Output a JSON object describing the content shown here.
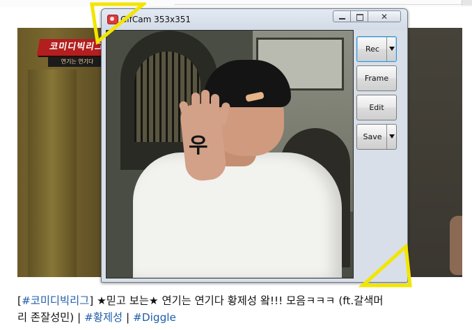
{
  "window": {
    "title": "GifCam 353x351",
    "min_label": "",
    "max_label": "",
    "close_label": "✕"
  },
  "buttons": {
    "rec": "Rec",
    "frame": "Frame",
    "edit": "Edit",
    "save": "Save"
  },
  "video": {
    "logo_main": "코미디빅리그",
    "logo_sub": "연기는 연기다",
    "hand_text": "우"
  },
  "caption": {
    "bracket_open": "[",
    "tag1": "#코미디빅리그",
    "bracket_close": "]",
    "text1": " ★믿고 보는★ 연기는 연기다 황제성 왘!!! 모음ㅋㅋㅋ (ft.갈색머",
    "text2": "리 존잘성민) | ",
    "tag2": "#황제성",
    "sep": " | ",
    "tag3": "#Diggle"
  },
  "colors": {
    "marker": "#f2e600",
    "link": "#1f5ea8",
    "rec_focus": "#3c8fc8"
  }
}
